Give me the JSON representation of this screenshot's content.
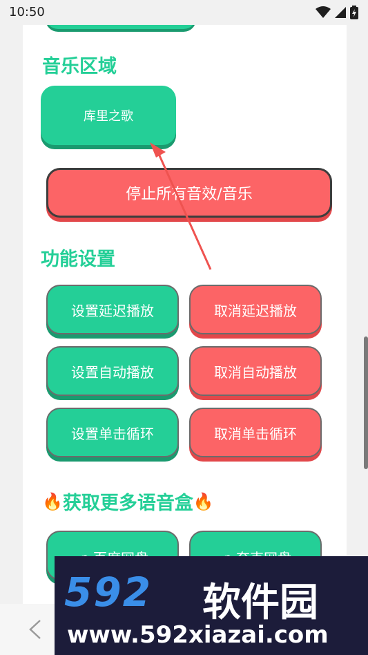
{
  "status": {
    "time": "10:50"
  },
  "music": {
    "title": "音乐区域",
    "song_button": "库里之歌",
    "stop_button": "停止所有音效/音乐"
  },
  "settings": {
    "title": "功能设置",
    "rows": [
      {
        "set": "设置延迟播放",
        "cancel": "取消延迟播放"
      },
      {
        "set": "设置自动播放",
        "cancel": "取消自动播放"
      },
      {
        "set": "设置单击循环",
        "cancel": "取消单击循环"
      }
    ]
  },
  "more": {
    "title": "获取更多语音盒",
    "fire_emoji": "🔥",
    "baidu": "百度网盘",
    "quark": "夸克网盘"
  },
  "watermark": {
    "logo": "592",
    "name": "软件园",
    "url": "www.592xiazai.com"
  },
  "colors": {
    "green": "#24cf97",
    "red": "#fc6466",
    "watermark_bg": "#1c1c3a"
  }
}
